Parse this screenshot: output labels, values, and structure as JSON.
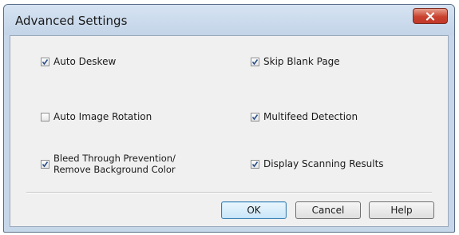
{
  "window": {
    "title": "Advanced Settings"
  },
  "options": {
    "auto_deskew": {
      "label": "Auto Deskew",
      "checked": true
    },
    "auto_image_rotation": {
      "label": "Auto Image Rotation",
      "checked": false
    },
    "bleed_through": {
      "label_line1": "Bleed Through Prevention/",
      "label_line2": "Remove Background Color",
      "checked": true
    },
    "skip_blank_page": {
      "label": "Skip Blank Page",
      "checked": true
    },
    "multifeed_detection": {
      "label": "Multifeed Detection",
      "checked": true
    },
    "display_scanning_results": {
      "label": "Display Scanning Results",
      "checked": true
    }
  },
  "buttons": {
    "ok": "OK",
    "cancel": "Cancel",
    "help": "Help"
  },
  "icons": {
    "close": "close-icon",
    "check": "check-icon"
  },
  "colors": {
    "close_button": "#c8432f",
    "default_button_border": "#3c7fb1",
    "window_frame": "#c7d7ea"
  }
}
